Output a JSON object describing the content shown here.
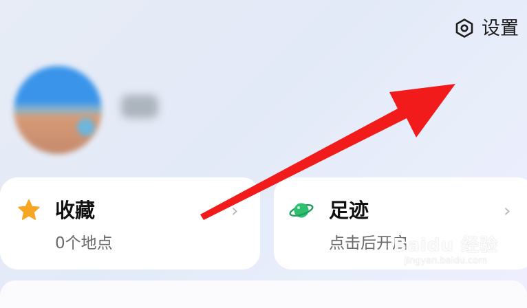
{
  "header": {
    "settings_label": "设置",
    "settings_icon": "gear-icon"
  },
  "profile": {
    "avatar_icon": "avatar",
    "username_blurred": true
  },
  "cards": {
    "favorites": {
      "icon": "star-icon",
      "title": "收藏",
      "subtitle": "0个地点"
    },
    "footprints": {
      "icon": "planet-icon",
      "title": "足迹",
      "subtitle": "点击后开启"
    }
  },
  "annotation": {
    "arrow_color": "#f21b1b"
  },
  "watermark": {
    "main": "Baidu 经验",
    "sub": "jingyan.baidu.com"
  },
  "colors": {
    "background": "#e5ebf7",
    "card": "#ffffff",
    "star": "#f6a623",
    "planet": "#2fbf71"
  }
}
